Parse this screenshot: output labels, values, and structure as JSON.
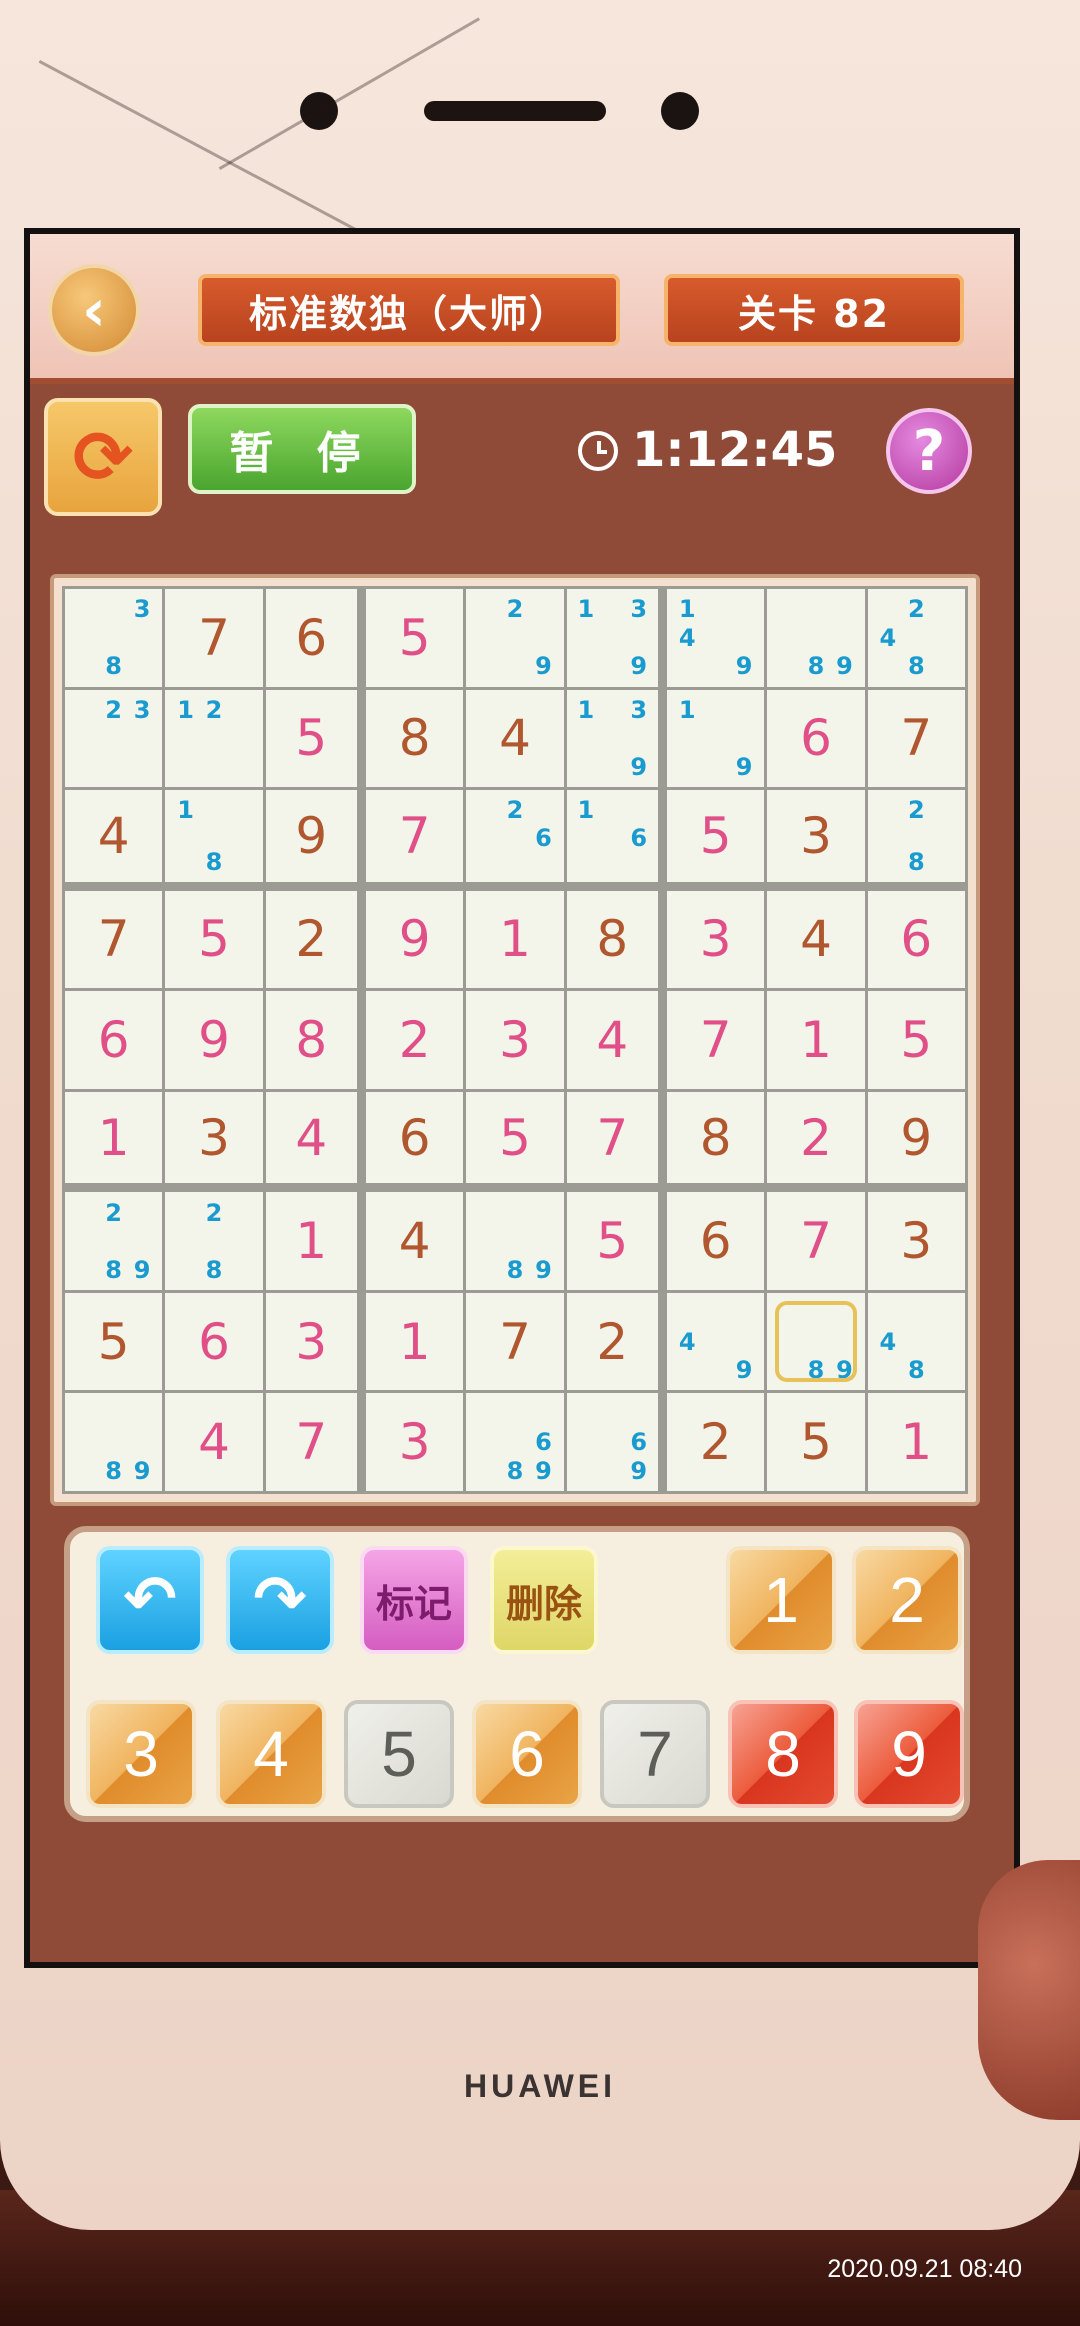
{
  "header": {
    "title": "标准数独（大师）",
    "level": "关卡 82"
  },
  "toolbar": {
    "pause_label": "暂 停",
    "timer": "1:12:45",
    "help_glyph": "?",
    "back_glyph": "‹",
    "restart_glyph": "⟳"
  },
  "board": {
    "cells": [
      [
        {
          "notes": [
            "3",
            "8"
          ]
        },
        {
          "v": "7",
          "t": "given"
        },
        {
          "v": "6",
          "t": "given"
        },
        {
          "v": "5",
          "t": "filled"
        },
        {
          "notes": [
            "2",
            "9"
          ]
        },
        {
          "notes": [
            "1",
            "3",
            "9"
          ]
        },
        {
          "notes": [
            "1",
            "4",
            "9"
          ]
        },
        {
          "notes": [
            "8",
            "9"
          ]
        },
        {
          "notes": [
            "2",
            "4",
            "8"
          ]
        }
      ],
      [
        {
          "notes": [
            "2",
            "3"
          ]
        },
        {
          "notes": [
            "1",
            "2"
          ]
        },
        {
          "v": "5",
          "t": "filled"
        },
        {
          "v": "8",
          "t": "given"
        },
        {
          "v": "4",
          "t": "given"
        },
        {
          "notes": [
            "1",
            "3",
            "9"
          ]
        },
        {
          "notes": [
            "1",
            "9"
          ]
        },
        {
          "v": "6",
          "t": "filled"
        },
        {
          "v": "7",
          "t": "given"
        }
      ],
      [
        {
          "v": "4",
          "t": "given"
        },
        {
          "notes": [
            "1",
            "8"
          ]
        },
        {
          "v": "9",
          "t": "given"
        },
        {
          "v": "7",
          "t": "filled"
        },
        {
          "notes": [
            "2",
            "6"
          ]
        },
        {
          "notes": [
            "1",
            "6"
          ]
        },
        {
          "v": "5",
          "t": "filled"
        },
        {
          "v": "3",
          "t": "given"
        },
        {
          "notes": [
            "2",
            "8"
          ]
        }
      ],
      [
        {
          "v": "7",
          "t": "given"
        },
        {
          "v": "5",
          "t": "filled"
        },
        {
          "v": "2",
          "t": "given"
        },
        {
          "v": "9",
          "t": "filled"
        },
        {
          "v": "1",
          "t": "filled"
        },
        {
          "v": "8",
          "t": "given"
        },
        {
          "v": "3",
          "t": "filled"
        },
        {
          "v": "4",
          "t": "given"
        },
        {
          "v": "6",
          "t": "filled"
        }
      ],
      [
        {
          "v": "6",
          "t": "filled"
        },
        {
          "v": "9",
          "t": "filled"
        },
        {
          "v": "8",
          "t": "filled"
        },
        {
          "v": "2",
          "t": "filled"
        },
        {
          "v": "3",
          "t": "filled"
        },
        {
          "v": "4",
          "t": "filled"
        },
        {
          "v": "7",
          "t": "filled"
        },
        {
          "v": "1",
          "t": "filled"
        },
        {
          "v": "5",
          "t": "filled"
        }
      ],
      [
        {
          "v": "1",
          "t": "filled"
        },
        {
          "v": "3",
          "t": "given"
        },
        {
          "v": "4",
          "t": "filled"
        },
        {
          "v": "6",
          "t": "given"
        },
        {
          "v": "5",
          "t": "filled"
        },
        {
          "v": "7",
          "t": "filled"
        },
        {
          "v": "8",
          "t": "given"
        },
        {
          "v": "2",
          "t": "filled"
        },
        {
          "v": "9",
          "t": "given"
        }
      ],
      [
        {
          "notes": [
            "2",
            "8",
            "9"
          ]
        },
        {
          "notes": [
            "2",
            "8"
          ]
        },
        {
          "v": "1",
          "t": "filled"
        },
        {
          "v": "4",
          "t": "given"
        },
        {
          "notes": [
            "8",
            "9"
          ]
        },
        {
          "v": "5",
          "t": "filled"
        },
        {
          "v": "6",
          "t": "given"
        },
        {
          "v": "7",
          "t": "filled"
        },
        {
          "v": "3",
          "t": "given"
        }
      ],
      [
        {
          "v": "5",
          "t": "given"
        },
        {
          "v": "6",
          "t": "filled"
        },
        {
          "v": "3",
          "t": "filled"
        },
        {
          "v": "1",
          "t": "filled"
        },
        {
          "v": "7",
          "t": "given"
        },
        {
          "v": "2",
          "t": "given"
        },
        {
          "notes": [
            "4",
            "9"
          ]
        },
        {
          "notes": [
            "8",
            "9"
          ],
          "selected": true
        },
        {
          "notes": [
            "4",
            "8"
          ]
        }
      ],
      [
        {
          "notes": [
            "8",
            "9"
          ]
        },
        {
          "v": "4",
          "t": "filled"
        },
        {
          "v": "7",
          "t": "filled"
        },
        {
          "v": "3",
          "t": "filled"
        },
        {
          "notes": [
            "6",
            "8",
            "9"
          ]
        },
        {
          "notes": [
            "6",
            "9"
          ]
        },
        {
          "v": "2",
          "t": "given"
        },
        {
          "v": "5",
          "t": "given"
        },
        {
          "v": "1",
          "t": "filled"
        }
      ]
    ]
  },
  "controls": {
    "undo_glyph": "↶",
    "redo_glyph": "↷",
    "mark_label": "标记",
    "erase_label": "删除",
    "numbers": [
      "1",
      "2",
      "3",
      "4",
      "5",
      "6",
      "7",
      "8",
      "9"
    ]
  },
  "device": {
    "brand": "HUAWEI",
    "timestamp": "2020.09.21 08:40"
  }
}
